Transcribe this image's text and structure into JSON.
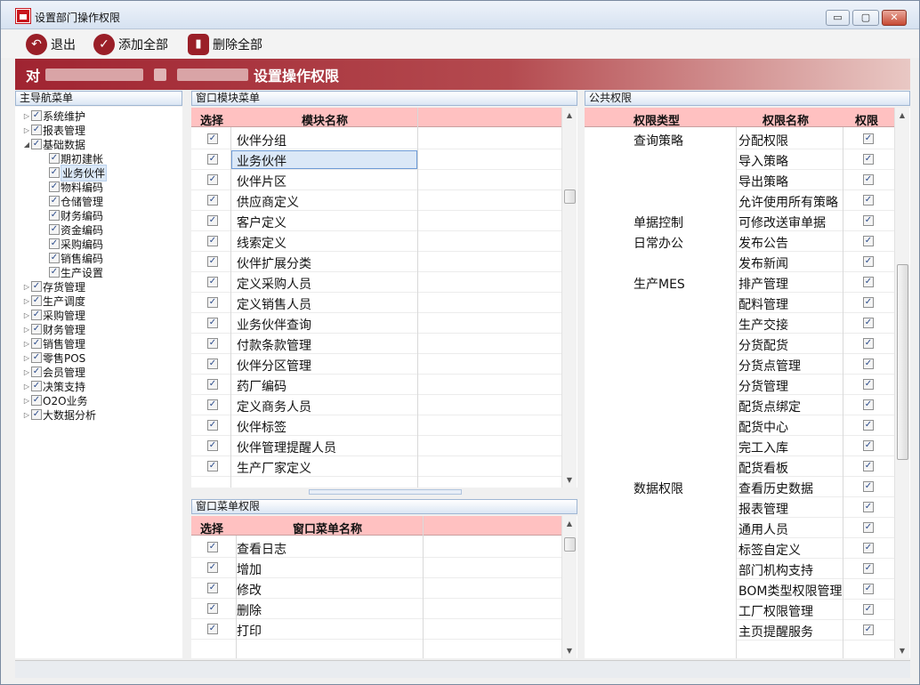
{
  "window": {
    "title": "设置部门操作权限",
    "minimize": "▭",
    "restore": "▢",
    "close": "✕"
  },
  "toolbar": {
    "exit_label": "退出",
    "add_all_label": "添加全部",
    "delete_all_label": "删除全部"
  },
  "banner": {
    "prefix": "对",
    "suffix": "设置操作权限"
  },
  "nav": {
    "header": "主导航菜单",
    "items": [
      {
        "label": "系统维护",
        "level": 0,
        "expander": "▷"
      },
      {
        "label": "报表管理",
        "level": 0,
        "expander": "▷"
      },
      {
        "label": "基础数据",
        "level": 0,
        "expander": "◢"
      },
      {
        "label": "期初建帐",
        "level": 1,
        "expander": ""
      },
      {
        "label": "业务伙伴",
        "level": 1,
        "expander": ""
      },
      {
        "label": "物料编码",
        "level": 1,
        "expander": ""
      },
      {
        "label": "仓储管理",
        "level": 1,
        "expander": ""
      },
      {
        "label": "财务编码",
        "level": 1,
        "expander": ""
      },
      {
        "label": "资金编码",
        "level": 1,
        "expander": ""
      },
      {
        "label": "采购编码",
        "level": 1,
        "expander": ""
      },
      {
        "label": "销售编码",
        "level": 1,
        "expander": ""
      },
      {
        "label": "生产设置",
        "level": 1,
        "expander": ""
      },
      {
        "label": "存货管理",
        "level": 0,
        "expander": "▷"
      },
      {
        "label": "生产调度",
        "level": 0,
        "expander": "▷"
      },
      {
        "label": "采购管理",
        "level": 0,
        "expander": "▷"
      },
      {
        "label": "财务管理",
        "level": 0,
        "expander": "▷"
      },
      {
        "label": "销售管理",
        "level": 0,
        "expander": "▷"
      },
      {
        "label": "零售POS",
        "level": 0,
        "expander": "▷"
      },
      {
        "label": "会员管理",
        "level": 0,
        "expander": "▷"
      },
      {
        "label": "决策支持",
        "level": 0,
        "expander": "▷"
      },
      {
        "label": "O2O业务",
        "level": 0,
        "expander": "▷"
      },
      {
        "label": "大数据分析",
        "level": 0,
        "expander": "▷"
      }
    ]
  },
  "module_grid": {
    "header": "窗口模块菜单",
    "col_select": "选择",
    "col_name": "模块名称",
    "checkmark": "✓",
    "rows": [
      "伙伴分组",
      "业务伙伴",
      "伙伴片区",
      "供应商定义",
      "客户定义",
      "线索定义",
      "伙伴扩展分类",
      "定义采购人员",
      "定义销售人员",
      "业务伙伴查询",
      "付款条款管理",
      "伙伴分区管理",
      "药厂编码",
      "定义商务人员",
      "伙伴标签",
      "伙伴管理提醒人员",
      "生产厂家定义"
    ]
  },
  "menu_grid": {
    "header": "窗口菜单权限",
    "col_select": "选择",
    "col_name": "窗口菜单名称",
    "rows": [
      "查看日志",
      "增加",
      "修改",
      "删除",
      "打印"
    ]
  },
  "public": {
    "header": "公共权限",
    "col_type": "权限类型",
    "col_name": "权限名称",
    "col_perm": "权限",
    "rows": [
      {
        "type": "查询策略",
        "name": "分配权限"
      },
      {
        "type": "",
        "name": "导入策略"
      },
      {
        "type": "",
        "name": "导出策略"
      },
      {
        "type": "",
        "name": "允许使用所有策略"
      },
      {
        "type": "单据控制",
        "name": "可修改送审单据"
      },
      {
        "type": "日常办公",
        "name": "发布公告"
      },
      {
        "type": "",
        "name": "发布新闻"
      },
      {
        "type": "生产MES",
        "name": "排产管理"
      },
      {
        "type": "",
        "name": "配料管理"
      },
      {
        "type": "",
        "name": "生产交接"
      },
      {
        "type": "",
        "name": "分货配货"
      },
      {
        "type": "",
        "name": "分货点管理"
      },
      {
        "type": "",
        "name": "分货管理"
      },
      {
        "type": "",
        "name": "配货点绑定"
      },
      {
        "type": "",
        "name": "配货中心"
      },
      {
        "type": "",
        "name": "完工入库"
      },
      {
        "type": "",
        "name": "配货看板"
      },
      {
        "type": "数据权限",
        "name": "查看历史数据"
      },
      {
        "type": "",
        "name": "报表管理"
      },
      {
        "type": "",
        "name": "通用人员"
      },
      {
        "type": "",
        "name": "标签自定义"
      },
      {
        "type": "",
        "name": "部门机构支持"
      },
      {
        "type": "",
        "name": "BOM类型权限管理"
      },
      {
        "type": "",
        "name": "工厂权限管理"
      },
      {
        "type": "",
        "name": "主页提醒服务"
      }
    ]
  },
  "colors": {
    "banner": "#a02431",
    "grid_header": "#ffc1c1",
    "icon": "#9a1f28"
  }
}
